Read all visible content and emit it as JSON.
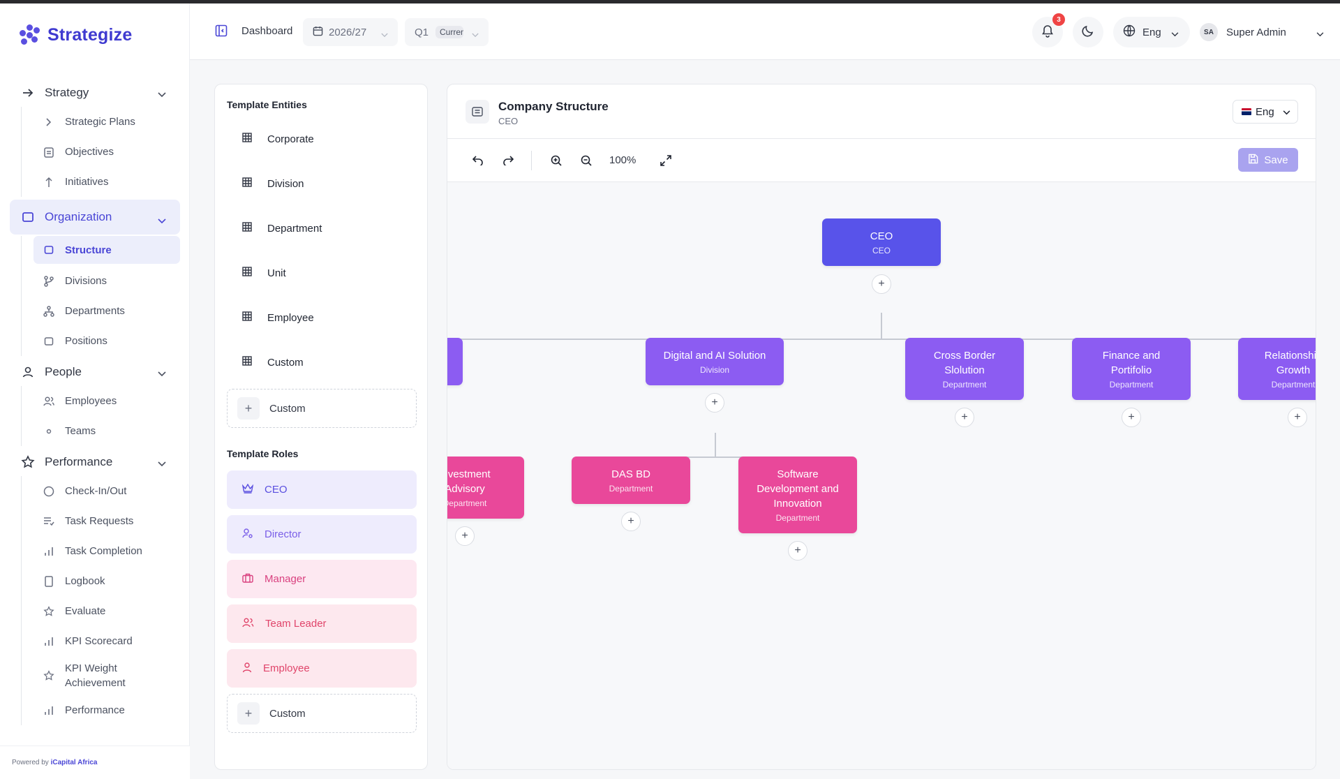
{
  "brand": {
    "name": "Strategize",
    "powered_prefix": "Powered by",
    "powered_name": "iCapital Africa"
  },
  "sidebar": {
    "groups": [
      {
        "label": "Strategy",
        "items": [
          "Strategic Plans",
          "Objectives",
          "Initiatives"
        ]
      },
      {
        "label": "Organization",
        "items": [
          "Structure",
          "Divisions",
          "Departments",
          "Positions"
        ]
      },
      {
        "label": "People",
        "items": [
          "Employees",
          "Teams"
        ]
      },
      {
        "label": "Performance",
        "items": [
          "Check-In/Out",
          "Task Requests",
          "Task Completion",
          "Logbook",
          "Evaluate",
          "KPI Scorecard",
          "KPI Weight Achievement",
          "Performance"
        ]
      }
    ],
    "active_group": "Organization",
    "active_item": "Structure"
  },
  "header": {
    "dashboard": "Dashboard",
    "year": "2026/27",
    "quarter": "Q1",
    "quarter_tag": "Current",
    "notifications": "3",
    "language": "Eng",
    "user_initials": "SA",
    "user_name": "Super Admin"
  },
  "templates": {
    "entities_title": "Template Entities",
    "entities": [
      "Corporate",
      "Division",
      "Department",
      "Unit",
      "Employee",
      "Custom"
    ],
    "add_entity": "Custom",
    "roles_title": "Template Roles",
    "roles": [
      "CEO",
      "Director",
      "Manager",
      "Team Leader",
      "Employee"
    ],
    "add_role": "Custom"
  },
  "structure": {
    "title": "Company Structure",
    "subtitle": "CEO",
    "language": "Eng",
    "zoom": "100%",
    "save_label": "Save",
    "nodes": {
      "ceo": {
        "title": "CEO",
        "type": "CEO"
      },
      "digital": {
        "title": "Digital and AI Solution",
        "type": "Division"
      },
      "crossborder": {
        "title": "Cross Border Slolution",
        "type": "Department"
      },
      "finance": {
        "title": "Finance and Portifolio",
        "type": "Department"
      },
      "relationship": {
        "title": "Relationship Growth",
        "type": "Department"
      },
      "investment": {
        "title": "Investment Advisory",
        "type": "Department"
      },
      "dasbd": {
        "title": "DAS BD",
        "type": "Department"
      },
      "software": {
        "title": "Software Development and Innovation",
        "type": "Department"
      }
    }
  },
  "colors": {
    "accent": "#4a46d6",
    "ceo": "#5853ea",
    "division": "#8c5cf2",
    "department": "#e9489a"
  }
}
